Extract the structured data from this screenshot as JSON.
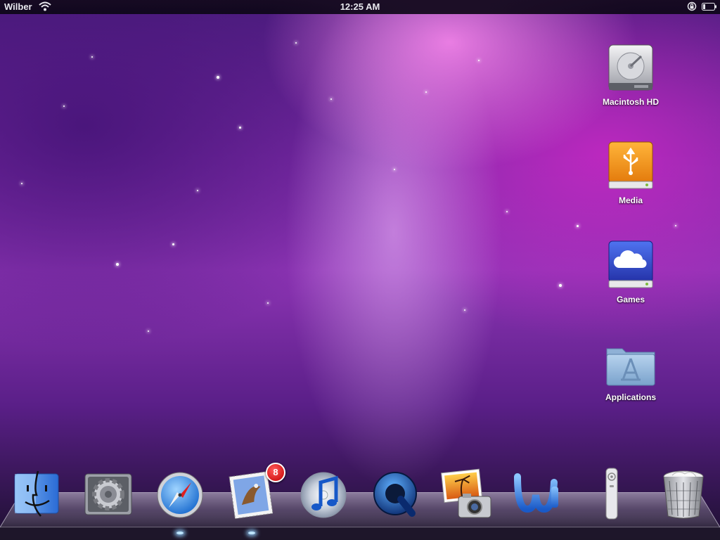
{
  "status_bar": {
    "carrier": "Wilber",
    "time": "12:25 AM",
    "icons": [
      "wifi-icon",
      "rotation-lock-icon",
      "battery-icon"
    ]
  },
  "desktop": {
    "icons": [
      {
        "label": "Macintosh HD",
        "icon": "hard-drive-icon"
      },
      {
        "label": "Media",
        "icon": "usb-drive-icon"
      },
      {
        "label": "Games",
        "icon": "cloud-drive-icon"
      },
      {
        "label": "Applications",
        "icon": "applications-folder-icon"
      }
    ]
  },
  "dock": {
    "items": [
      {
        "icon": "finder-icon"
      },
      {
        "icon": "system-preferences-icon"
      },
      {
        "icon": "safari-icon"
      },
      {
        "icon": "mail-icon",
        "badge": "8"
      },
      {
        "icon": "itunes-icon"
      },
      {
        "icon": "quicktime-icon"
      },
      {
        "icon": "iphoto-icon"
      },
      {
        "icon": "word-icon"
      },
      {
        "icon": "apple-remote-icon"
      },
      {
        "icon": "trash-icon"
      }
    ]
  },
  "colors": {
    "status_bar": "#140a1e",
    "badge": "#d40000",
    "usb_drive": "#f59a1c",
    "cloud_drive": "#3a5bd8",
    "folder": "#8fb4d8"
  }
}
